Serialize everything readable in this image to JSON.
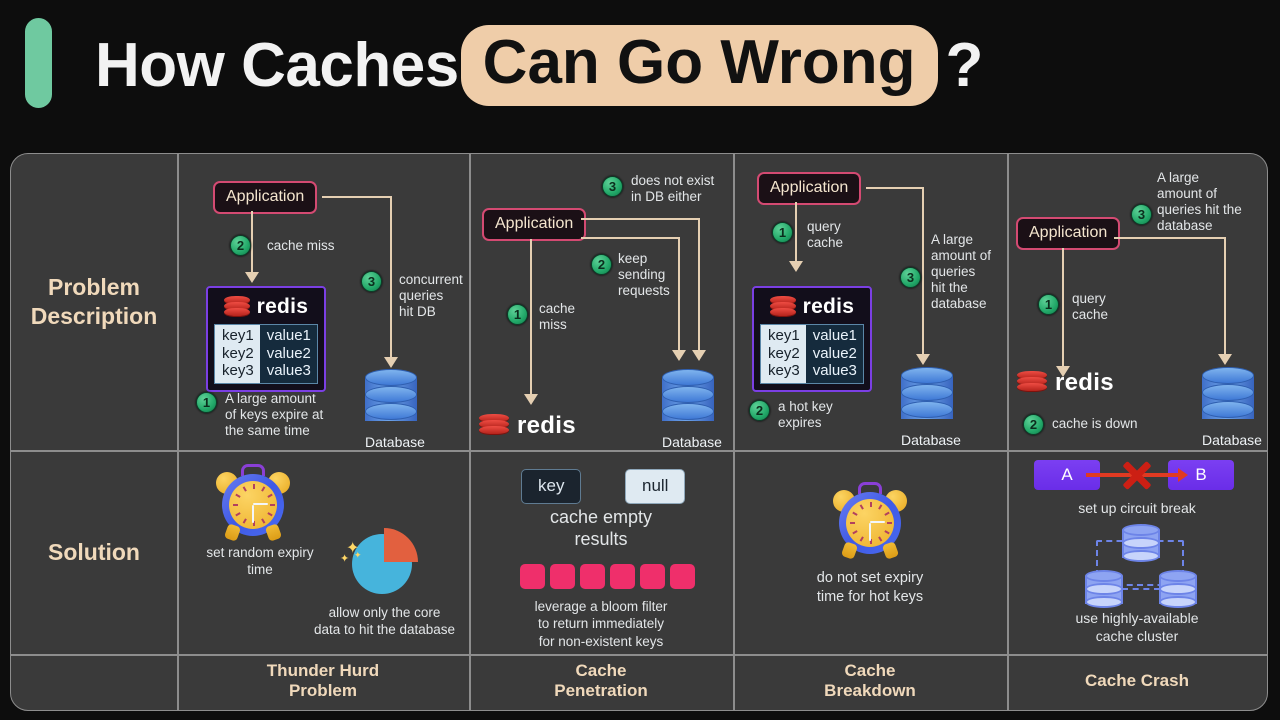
{
  "header": {
    "title_plain": "How Caches",
    "title_highlight": "Can Go Wrong",
    "title_suffix": "?",
    "accent_bar_color": "#6fc9a0",
    "highlight_color": "#efcda9"
  },
  "rows": {
    "problem_label": "Problem\nDescription",
    "problem_label_line1": "Problem",
    "problem_label_line2": "Description",
    "solution_label": "Solution"
  },
  "columns": [
    {
      "name": "Thunder Hurd Problem",
      "bottom_label_line1": "Thunder Hurd",
      "bottom_label_line2": "Problem",
      "problem": {
        "app_box": "Application",
        "redis_word": "redis",
        "keys": [
          "key1",
          "key2",
          "key3"
        ],
        "values": [
          "value1",
          "value2",
          "value3"
        ],
        "db_caption": "Database",
        "steps": [
          {
            "num": "1",
            "text_line1": "A large amount",
            "text_line2": "of keys expire at",
            "text_line3": "the same time"
          },
          {
            "num": "2",
            "text_line1": "cache miss"
          },
          {
            "num": "3",
            "text_line1": "concurrent",
            "text_line2": "queries",
            "text_line3": "hit DB"
          }
        ]
      },
      "solution": {
        "icon_1": "alarm-clock",
        "caption_1_line1": "set random expiry",
        "caption_1_line2": "time",
        "icon_2": "pie-chart",
        "caption_2_line1": "allow only the core",
        "caption_2_line2": "data to hit the database"
      }
    },
    {
      "name": "Cache Penetration",
      "bottom_label_line1": "Cache",
      "bottom_label_line2": "Penetration",
      "problem": {
        "app_box": "Application",
        "redis_word": "redis",
        "db_caption": "Database",
        "steps": [
          {
            "num": "1",
            "text_line1": "cache",
            "text_line2": "miss"
          },
          {
            "num": "2",
            "text_line1": "keep",
            "text_line2": "sending",
            "text_line3": "requests"
          },
          {
            "num": "3",
            "text_line1": "does not exist",
            "text_line2": "in DB either"
          }
        ]
      },
      "solution": {
        "chip_key": "key",
        "chip_null": "null",
        "caption_1_line1": "cache empty",
        "caption_1_line2": "results",
        "bloom_bits": 6,
        "bloom_bit_color": "#ef2f6b",
        "caption_2_line1": "leverage a bloom filter",
        "caption_2_line2": "to return immediately",
        "caption_2_line3": "for non-existent keys"
      }
    },
    {
      "name": "Cache Breakdown",
      "bottom_label_line1": "Cache",
      "bottom_label_line2": "Breakdown",
      "problem": {
        "app_box": "Application",
        "redis_word": "redis",
        "keys": [
          "key1",
          "key2",
          "key3"
        ],
        "values": [
          "value1",
          "value2",
          "value3"
        ],
        "db_caption": "Database",
        "steps": [
          {
            "num": "1",
            "text_line1": "query",
            "text_line2": "cache"
          },
          {
            "num": "2",
            "text_line1": "a hot key",
            "text_line2": "expires"
          },
          {
            "num": "3",
            "text_line1": "A large",
            "text_line2": "amount of",
            "text_line3": "queries",
            "text_line4": "hit the",
            "text_line5": "database"
          }
        ]
      },
      "solution": {
        "icon_1": "alarm-clock",
        "caption_1_line1": "do not set expiry",
        "caption_1_line2": "time for hot keys"
      }
    },
    {
      "name": "Cache Crash",
      "bottom_label_line1": "Cache Crash",
      "bottom_label_line2": "",
      "problem": {
        "app_box": "Application",
        "redis_word": "redis",
        "db_caption": "Database",
        "steps": [
          {
            "num": "1",
            "text_line1": "query",
            "text_line2": "cache"
          },
          {
            "num": "2",
            "text_line1": "cache is down"
          },
          {
            "num": "3",
            "text_line1": "A large",
            "text_line2": "amount of",
            "text_line3": "queries hit the",
            "text_line4": "database"
          }
        ]
      },
      "solution": {
        "node_a": "A",
        "node_b": "B",
        "caption_1": "set up circuit break",
        "caption_2_line1": "use highly-available",
        "caption_2_line2": "cache cluster"
      }
    }
  ]
}
